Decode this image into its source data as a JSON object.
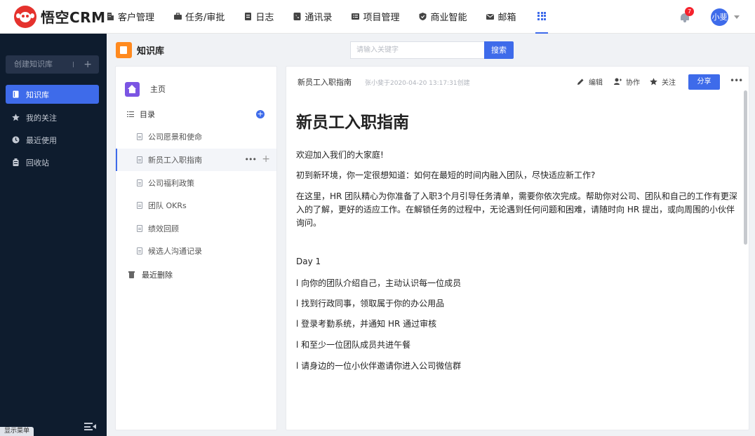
{
  "app": {
    "logo_text": "悟空CRM"
  },
  "topnav": {
    "items": [
      {
        "label": "客户管理",
        "icon": "building-icon"
      },
      {
        "label": "任务/审批",
        "icon": "briefcase-icon"
      },
      {
        "label": "日志",
        "icon": "log-icon"
      },
      {
        "label": "通讯录",
        "icon": "contacts-icon"
      },
      {
        "label": "项目管理",
        "icon": "list-icon"
      },
      {
        "label": "商业智能",
        "icon": "shield-icon"
      },
      {
        "label": "邮箱",
        "icon": "mail-icon"
      }
    ],
    "apps_icon": "apps-grid-icon",
    "notification_count": "7",
    "user_name": "小斐"
  },
  "sidebar": {
    "create_label": "创建知识库",
    "create_plus": "+",
    "items": [
      {
        "label": "知识库",
        "icon": "book-icon",
        "active": true
      },
      {
        "label": "我的关注",
        "icon": "star-icon",
        "active": false
      },
      {
        "label": "最近使用",
        "icon": "clock-icon",
        "active": false
      },
      {
        "label": "回收站",
        "icon": "recycle-icon",
        "active": false
      }
    ],
    "show_menu_label": "显示菜单"
  },
  "header": {
    "title": "知识库",
    "search_placeholder": "请输入关键字",
    "search_button": "搜索"
  },
  "directory": {
    "home_label": "主页",
    "toc_label": "目录",
    "toc_add": "+",
    "items": [
      {
        "label": "公司愿景和使命"
      },
      {
        "label": "新员工入职指南",
        "active": true
      },
      {
        "label": "公司福利政策"
      },
      {
        "label": "团队 OKRs"
      },
      {
        "label": "绩效回顾"
      },
      {
        "label": "候选人沟通记录"
      }
    ],
    "item_more": "•••",
    "item_add": "+",
    "trash_label": "最近删除"
  },
  "document": {
    "head_title": "新员工入职指南",
    "head_meta": "张小斐于2020-04-20 13:17:31创建",
    "actions": {
      "edit": "编辑",
      "collaborate": "协作",
      "follow": "关注",
      "share": "分享",
      "more": "•••"
    },
    "title": "新员工入职指南",
    "paragraphs": [
      "欢迎加入我们的大家庭!",
      "初到新环境，你一定很想知道：如何在最短的时间内融入团队，尽快适应新工作?",
      "在这里，HR 团队精心为你准备了入职3个月引导任务清单，需要你依次完成。帮助你对公司、团队和自己的工作有更深入的了解，更好的适应工作。在解锁任务的过程中，无论遇到任何问题和困难，请随时向 HR 提出，或向周围的小伙伴询问。"
    ],
    "day_label": "Day 1",
    "tasks": [
      "l  向你的团队介绍自己，主动认识每一位成员",
      "l  找到行政同事，领取属于你的办公用品",
      "l  登录考勤系统，并通知 HR 通过审核",
      "l  和至少一位团队成员共进午餐",
      "l  请身边的一位小伙伴邀请你进入公司微信群"
    ]
  },
  "colors": {
    "brand_red": "#e5322d",
    "accent_blue": "#3e6bea",
    "sidebar_bg": "#0e1c2e",
    "kb_orange": "#ff8a1f",
    "home_purple": "#7b55e3"
  }
}
